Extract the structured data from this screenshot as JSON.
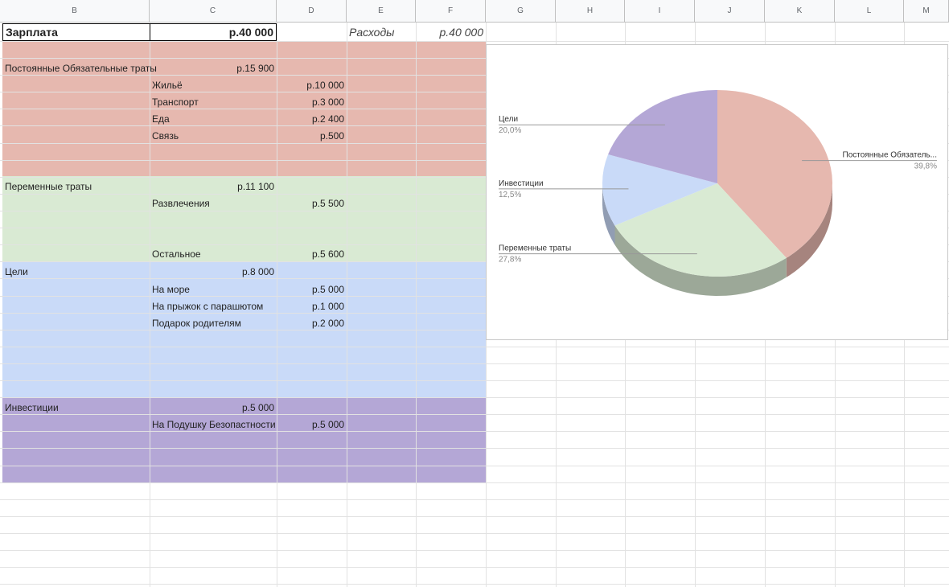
{
  "columns": [
    "B",
    "C",
    "D",
    "E",
    "F",
    "G",
    "H",
    "I",
    "J",
    "K",
    "L",
    "M"
  ],
  "colors": {
    "fixed": "#e6b8af",
    "variable": "#d9ead3",
    "goals": "#c9daf8",
    "invest": "#b4a7d6"
  },
  "header": {
    "salary_label": "Зарплата",
    "salary_value": "р.40 000",
    "expenses_label": "Расходы",
    "expenses_value": "р.40 000"
  },
  "sections": {
    "fixed": {
      "label": "Постоянные Обязательные траты",
      "total": "р.15 900",
      "items": [
        {
          "name": "Жильё",
          "value": "р.10 000"
        },
        {
          "name": "Транспорт",
          "value": "р.3 000"
        },
        {
          "name": "Еда",
          "value": "р.2 400"
        },
        {
          "name": "Связь",
          "value": "р.500"
        }
      ]
    },
    "variable": {
      "label": "Переменные траты",
      "total": "р.11 100",
      "items": [
        {
          "name": "Развлечения",
          "value": "р.5 500"
        },
        {
          "name": "Остальное",
          "value": "р.5 600"
        }
      ]
    },
    "goals": {
      "label": "Цели",
      "total": "р.8 000",
      "items": [
        {
          "name": "На море",
          "value": "р.5 000"
        },
        {
          "name": "На прыжок с парашютом",
          "value": "р.1 000"
        },
        {
          "name": "Подарок родителям",
          "value": "р.2 000"
        }
      ]
    },
    "invest": {
      "label": "Инвестиции",
      "total": "р.5 000",
      "items": [
        {
          "name": "На Подушку Безопастности",
          "value": "р.5 000"
        }
      ]
    }
  },
  "chart_data": {
    "type": "pie",
    "slices": [
      {
        "label": "Постоянные Обязатель...",
        "value": 39.8,
        "pct": "39,8%",
        "color": "#e6b8af"
      },
      {
        "label": "Переменные траты",
        "value": 27.8,
        "pct": "27,8%",
        "color": "#d9ead3"
      },
      {
        "label": "Инвестиции",
        "value": 12.5,
        "pct": "12,5%",
        "color": "#c9daf8"
      },
      {
        "label": "Цели",
        "value": 20.0,
        "pct": "20,0%",
        "color": "#b4a7d6"
      }
    ]
  }
}
